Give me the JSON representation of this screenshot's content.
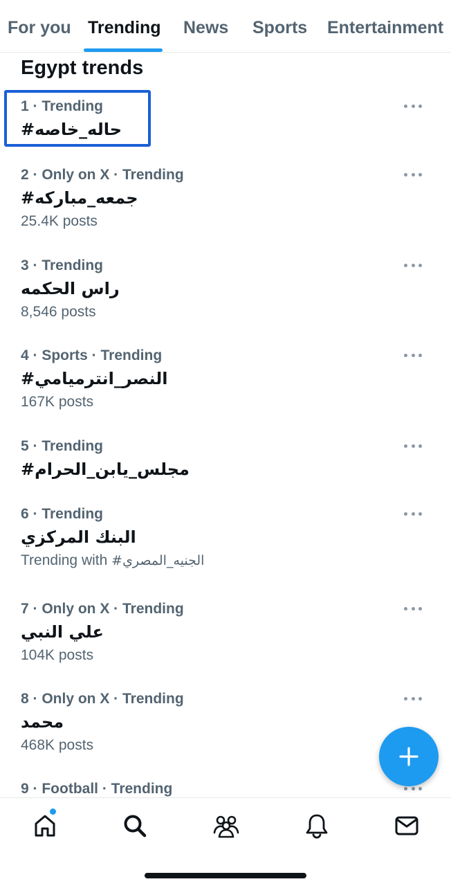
{
  "tabs": [
    {
      "label": "For you",
      "active": false
    },
    {
      "label": "Trending",
      "active": true
    },
    {
      "label": "News",
      "active": false
    },
    {
      "label": "Sports",
      "active": false
    },
    {
      "label": "Entertainment",
      "active": false
    }
  ],
  "section_title": "Egypt trends",
  "trends": [
    {
      "meta": "1 · Trending",
      "name": "#حاله_خاصه",
      "posts": ""
    },
    {
      "meta": "2 · Only on X · Trending",
      "name": "#جمعه_مباركه",
      "posts": "25.4K posts"
    },
    {
      "meta": "3 · Trending",
      "name": "راس الحكمه",
      "posts": "8,546 posts"
    },
    {
      "meta": "4 · Sports · Trending",
      "name": "#النصر_انترميامي",
      "posts": "167K posts"
    },
    {
      "meta": "5 · Trending",
      "name": "#مجلس_يابن_الحرام",
      "posts": ""
    },
    {
      "meta": "6 · Trending",
      "name": "البنك المركزي",
      "posts_prefix": "Trending with",
      "posts_tag": "#الجنيه_المصري"
    },
    {
      "meta": "7 · Only on X · Trending",
      "name": "علي النبي",
      "posts": "104K posts"
    },
    {
      "meta": "8 · Only on X · Trending",
      "name": "محمد",
      "posts": "468K posts"
    },
    {
      "meta": "9 · Football · Trending",
      "name": "",
      "posts": ""
    }
  ],
  "colors": {
    "accent": "#1d9bf0",
    "highlight_box": "#1a5fd6",
    "secondary_text": "#536471"
  },
  "icons": {
    "compose": "plus-icon",
    "nav": [
      "home-icon",
      "search-icon",
      "communities-icon",
      "bell-icon",
      "mail-icon"
    ]
  }
}
